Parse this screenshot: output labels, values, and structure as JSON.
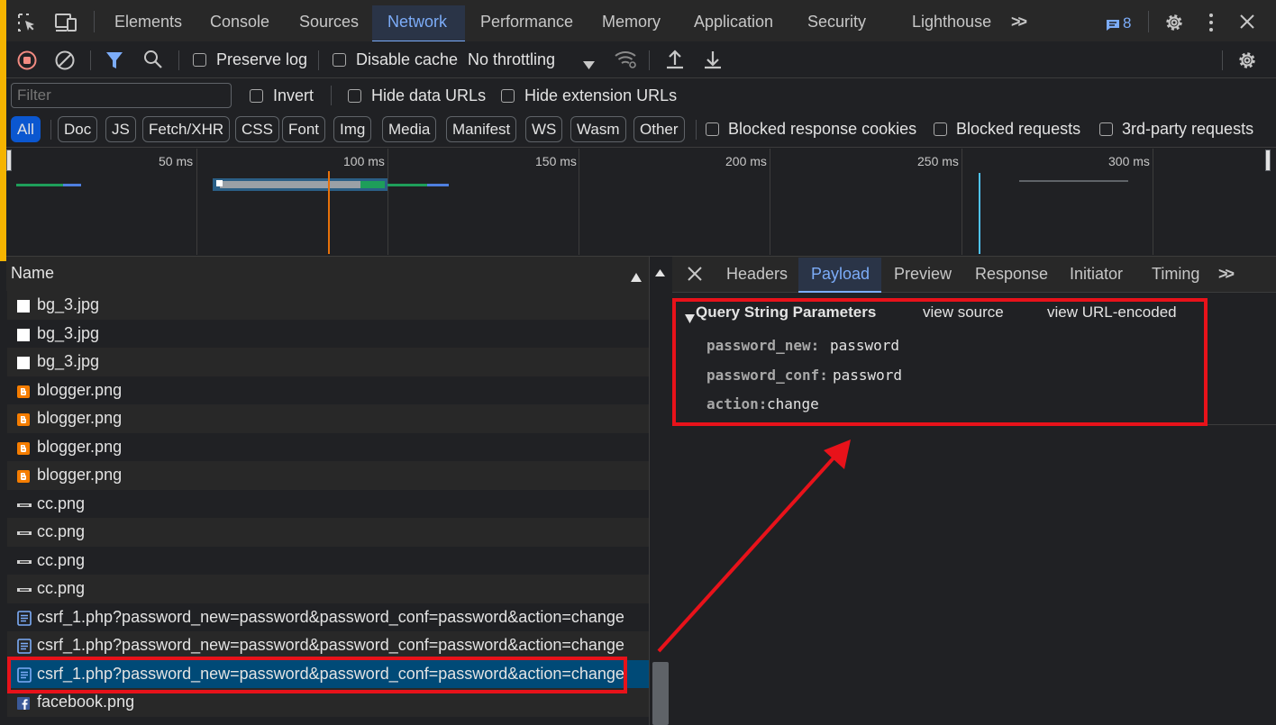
{
  "tabs": [
    "Elements",
    "Console",
    "Sources",
    "Network",
    "Performance",
    "Memory",
    "Application",
    "Security",
    "Lighthouse"
  ],
  "active_tab": "Network",
  "more_tabs_glyph": ">>",
  "issues_count": "8",
  "toolbar": {
    "preserve_log": "Preserve log",
    "disable_cache": "Disable cache",
    "throttling": "No throttling"
  },
  "filter": {
    "placeholder": "Filter",
    "invert": "Invert",
    "hide_data_urls": "Hide data URLs",
    "hide_extension_urls": "Hide extension URLs"
  },
  "type_filters": [
    "All",
    "Doc",
    "JS",
    "Fetch/XHR",
    "CSS",
    "Font",
    "Img",
    "Media",
    "Manifest",
    "WS",
    "Wasm",
    "Other"
  ],
  "extra_filters": {
    "blocked_cookies": "Blocked response cookies",
    "blocked_requests": "Blocked requests",
    "third_party": "3rd-party requests"
  },
  "timeline_ticks": [
    "50 ms",
    "100 ms",
    "150 ms",
    "200 ms",
    "250 ms",
    "300 ms"
  ],
  "request_list": {
    "header": "Name",
    "rows": [
      {
        "name": "bg_3.jpg",
        "icon": "image-file-icon"
      },
      {
        "name": "bg_3.jpg",
        "icon": "image-file-icon"
      },
      {
        "name": "bg_3.jpg",
        "icon": "image-file-icon"
      },
      {
        "name": "blogger.png",
        "icon": "blogger-icon"
      },
      {
        "name": "blogger.png",
        "icon": "blogger-icon"
      },
      {
        "name": "blogger.png",
        "icon": "blogger-icon"
      },
      {
        "name": "blogger.png",
        "icon": "blogger-icon"
      },
      {
        "name": "cc.png",
        "icon": "cc-icon"
      },
      {
        "name": "cc.png",
        "icon": "cc-icon"
      },
      {
        "name": "cc.png",
        "icon": "cc-icon"
      },
      {
        "name": "cc.png",
        "icon": "cc-icon"
      },
      {
        "name": "csrf_1.php?password_new=password&password_conf=password&action=change",
        "icon": "document-icon"
      },
      {
        "name": "csrf_1.php?password_new=password&password_conf=password&action=change",
        "icon": "document-icon"
      },
      {
        "name": "csrf_1.php?password_new=password&password_conf=password&action=change",
        "icon": "document-icon",
        "selected": true
      },
      {
        "name": "facebook.png",
        "icon": "facebook-icon"
      }
    ]
  },
  "detail_tabs": [
    "Headers",
    "Payload",
    "Preview",
    "Response",
    "Initiator",
    "Timing"
  ],
  "active_detail_tab": "Payload",
  "payload": {
    "section_title": "Query String Parameters",
    "view_source": "view source",
    "view_url_encoded": "view URL-encoded",
    "params": [
      {
        "key": "password_new:",
        "value": "password"
      },
      {
        "key": "password_conf:",
        "value": "password"
      },
      {
        "key": "action:",
        "value": "change"
      }
    ]
  },
  "colors": {
    "accent": "#7cacf8",
    "selected_row": "#004a77",
    "annotation": "#e8121a",
    "record": "#f28b82"
  }
}
